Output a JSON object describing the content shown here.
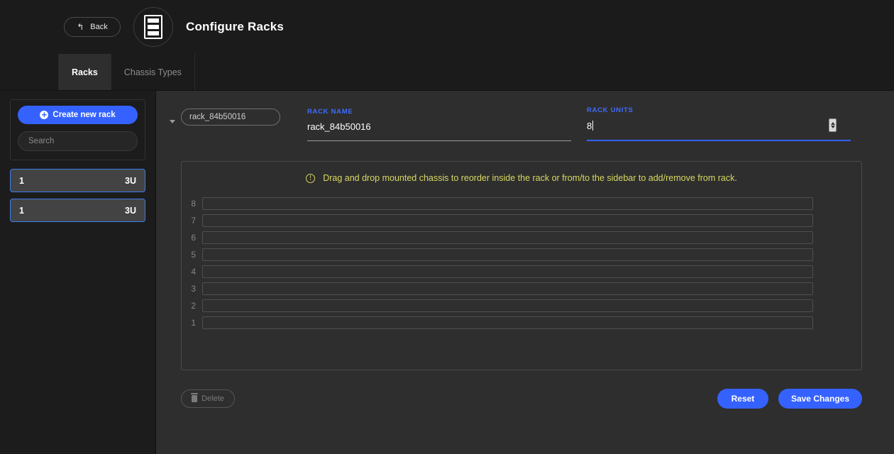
{
  "header": {
    "back_label": "Back",
    "back_icon": "back-arrow-icon",
    "logo_icon": "rack-icon",
    "title": "Configure Racks"
  },
  "tabs": [
    {
      "label": "Racks",
      "active": true
    },
    {
      "label": "Chassis Types",
      "active": false
    }
  ],
  "sidebar": {
    "create_button": {
      "label": "Create new rack",
      "icon": "plus-circle-icon"
    },
    "search": {
      "placeholder": "Search",
      "value": ""
    },
    "racks": [
      {
        "name": "1",
        "units": "3U"
      },
      {
        "name": "1",
        "units": "3U"
      }
    ]
  },
  "form": {
    "rack_select": {
      "value": "rack_84b50016",
      "options": [
        "rack_84b50016"
      ],
      "caret_icon": "chevron-down-icon"
    },
    "rack_name": {
      "label": "RACK NAME",
      "value": "rack_84b50016"
    },
    "rack_units": {
      "label": "RACK UNITS",
      "value": "8",
      "focused": true,
      "spinner_icon": "number-spinner-icon"
    }
  },
  "rack_panel": {
    "notice": {
      "icon": "info-circle-icon",
      "text": "Drag and drop mounted chassis to reorder inside the rack or from/to the sidebar to add/remove from rack."
    },
    "slots": [
      {
        "number": "8",
        "occupant": ""
      },
      {
        "number": "7",
        "occupant": ""
      },
      {
        "number": "6",
        "occupant": ""
      },
      {
        "number": "5",
        "occupant": ""
      },
      {
        "number": "4",
        "occupant": ""
      },
      {
        "number": "3",
        "occupant": ""
      },
      {
        "number": "2",
        "occupant": ""
      },
      {
        "number": "1",
        "occupant": ""
      }
    ]
  },
  "footer": {
    "delete": {
      "label": "Delete",
      "icon": "trash-icon",
      "disabled": true
    },
    "reset": {
      "label": "Reset"
    },
    "save": {
      "label": "Save Changes"
    }
  },
  "colors": {
    "accent": "#3562ff",
    "notice": "#d8d864",
    "label": "#3f6bff",
    "page_bg": "#2e2e2e",
    "header_bg": "#1b1b1b",
    "sidebar_bg": "#1c1c1c"
  }
}
